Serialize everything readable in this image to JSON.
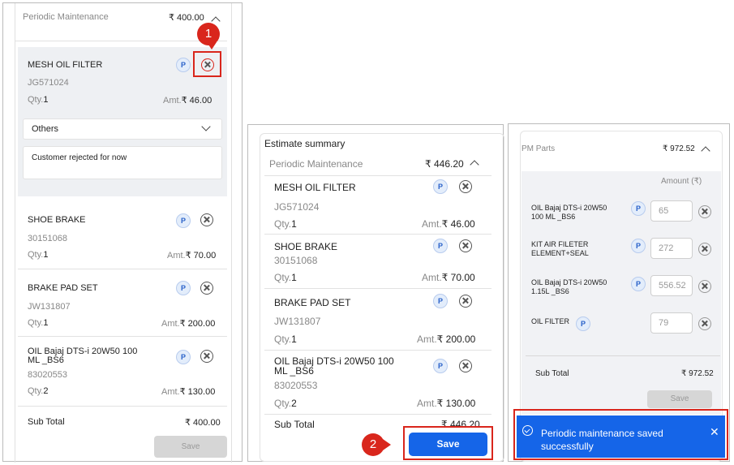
{
  "colors": {
    "accent_blue": "#1565e8",
    "red": "#d9261c",
    "gray_button": "#d6d6d6"
  },
  "panel1": {
    "section_title": "Periodic Maintenance",
    "section_amount": "₹ 400.00",
    "marker": "1",
    "items": [
      {
        "name": "MESH OIL FILTER",
        "code": "JG571024",
        "qty_label": "Qty.",
        "qty": "1",
        "amt_label": "Amt.",
        "amt": "₹ 46.00",
        "tag": "P"
      },
      {
        "name": "SHOE BRAKE",
        "code": "30151068",
        "qty_label": "Qty.",
        "qty": "1",
        "amt_label": "Amt.",
        "amt": "₹ 70.00",
        "tag": "P"
      },
      {
        "name": "BRAKE PAD SET",
        "code": "JW131807",
        "qty_label": "Qty.",
        "qty": "1",
        "amt_label": "Amt.",
        "amt": "₹ 200.00",
        "tag": "P"
      },
      {
        "name_line1": "OIL Bajaj DTS-i 20W50 100",
        "name_line2": "ML _BS6",
        "code": "83020553",
        "qty_label": "Qty.",
        "qty": "2",
        "amt_label": "Amt.",
        "amt": "₹ 130.00",
        "tag": "P"
      }
    ],
    "reason_select": "Others",
    "reason_text": "Customer rejected for now",
    "subtotal_label": "Sub Total",
    "subtotal": "₹ 400.00",
    "save_label": "Save"
  },
  "panel2": {
    "title": "Estimate summary",
    "section_title": "Periodic Maintenance",
    "section_amount": "₹ 446.20",
    "marker": "2",
    "items": [
      {
        "name": "MESH OIL FILTER",
        "code": "JG571024",
        "qty_label": "Qty.",
        "qty": "1",
        "amt_label": "Amt.",
        "amt": "₹ 46.00",
        "tag": "P"
      },
      {
        "name": "SHOE BRAKE",
        "code": "30151068",
        "qty_label": "Qty.",
        "qty": "1",
        "amt_label": "Amt.",
        "amt": "₹ 70.00",
        "tag": "P"
      },
      {
        "name": "BRAKE PAD SET",
        "code": "JW131807",
        "qty_label": "Qty.",
        "qty": "1",
        "amt_label": "Amt.",
        "amt": "₹ 200.00",
        "tag": "P"
      },
      {
        "name_line1": "OIL Bajaj DTS-i 20W50 100",
        "name_line2": "ML _BS6",
        "code": "83020553",
        "qty_label": "Qty.",
        "qty": "2",
        "amt_label": "Amt.",
        "amt": "₹ 130.00",
        "tag": "P"
      }
    ],
    "subtotal_label": "Sub Total",
    "subtotal": "₹ 446.20",
    "save_label": "Save"
  },
  "panel3": {
    "section_title": "PM Parts",
    "section_amount": "₹ 972.52",
    "amount_header": "Amount (₹)",
    "items": [
      {
        "line1": "OIL Bajaj DTS-i 20W50",
        "line2": "100 ML _BS6",
        "value": "65",
        "tag": "P"
      },
      {
        "line1": "KIT AIR FILETER",
        "line2": "ELEMENT+SEAL",
        "value": "272",
        "tag": "P"
      },
      {
        "line1": "OIL Bajaj DTS-i 20W50",
        "line2": "1.15L _BS6",
        "value": "556.52",
        "tag": "P"
      },
      {
        "line1": "OIL FILTER",
        "line2": "",
        "value": "79",
        "tag": "P"
      }
    ],
    "subtotal_label": "Sub Total",
    "subtotal": "₹ 972.52",
    "save_label": "Save",
    "toast_line1": "Periodic maintenance saved",
    "toast_line2": "successfully"
  }
}
